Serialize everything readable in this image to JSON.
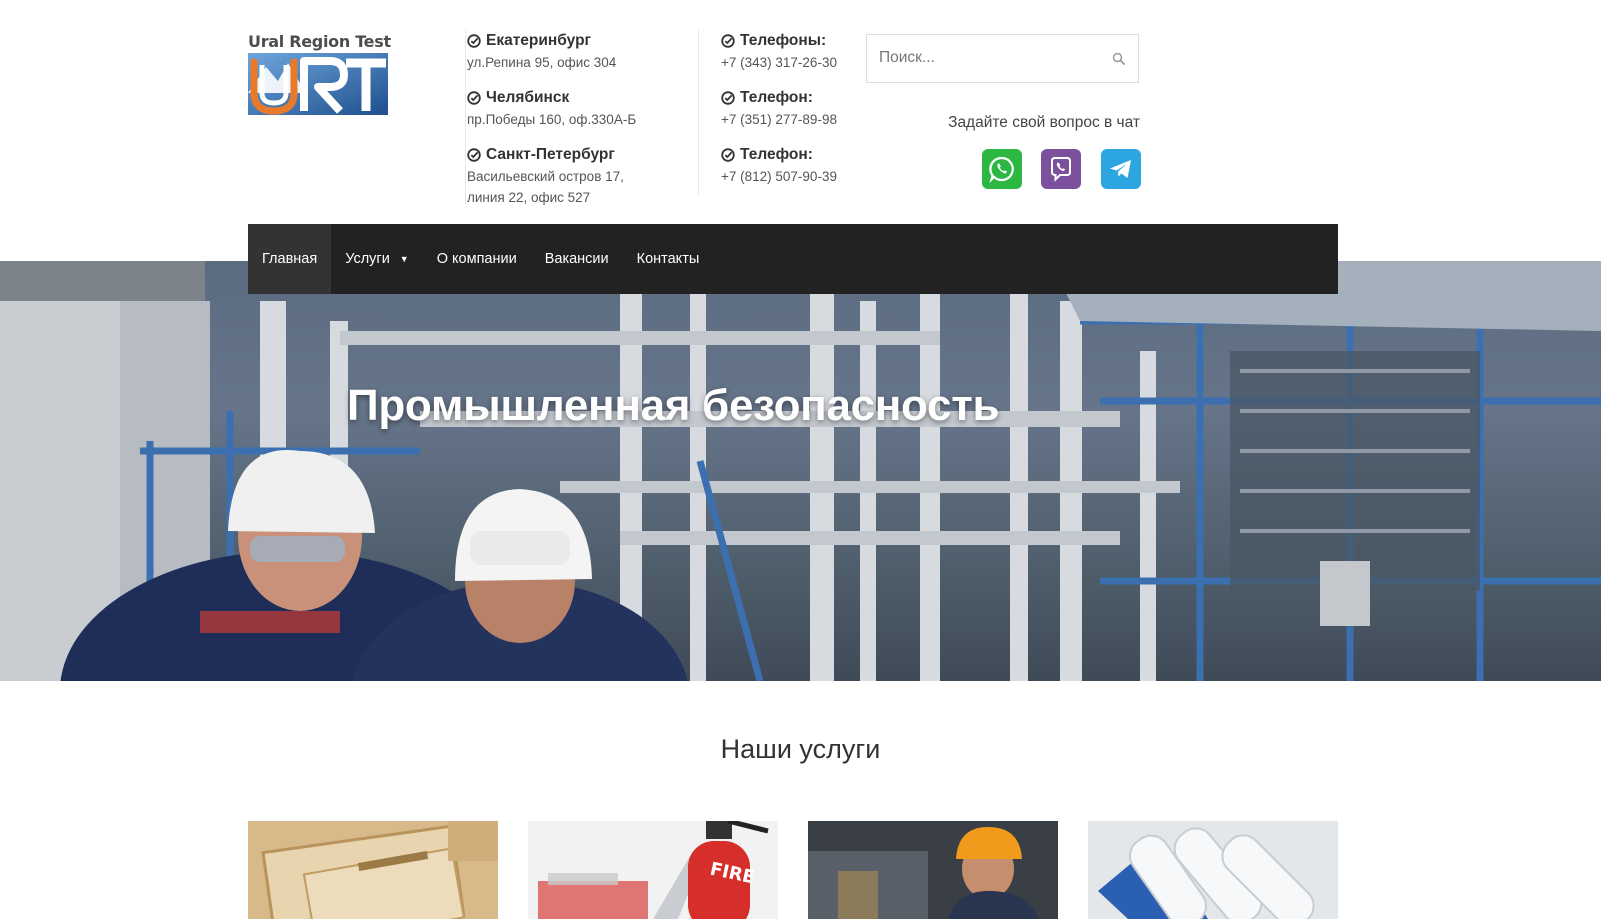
{
  "logo": {
    "text": "Ural Region Test",
    "mark": "URT"
  },
  "cities": [
    {
      "name": "Екатеринбург",
      "address": "ул.Репина 95, офис 304"
    },
    {
      "name": "Челябинск",
      "address": "пр.Победы 160, оф.330А-Б"
    },
    {
      "name": "Санкт-Петербург",
      "address": "Васильевский остров 17, линия 22, офис 527"
    }
  ],
  "phones": [
    {
      "label": "Телефоны:",
      "number": "+7 (343) 317-26-30"
    },
    {
      "label": "Телефон:",
      "number": "+7 (351) 277-89-98"
    },
    {
      "label": "Телефон:",
      "number": "+7 (812) 507-90-39"
    }
  ],
  "search": {
    "placeholder": "Поиск..."
  },
  "chat": {
    "label": "Задайте свой вопрос в чат",
    "messengers": [
      "whatsapp-icon",
      "viber-icon",
      "telegram-icon"
    ]
  },
  "nav": {
    "items": [
      {
        "label": "Главная",
        "active": true
      },
      {
        "label": "Услуги",
        "dropdown": true
      },
      {
        "label": "О компании"
      },
      {
        "label": "Вакансии"
      },
      {
        "label": "Контакты"
      }
    ]
  },
  "hero": {
    "title": "Промышленная безопасность"
  },
  "services": {
    "title": "Наши услуги"
  },
  "colors": {
    "nav_bg": "#222222",
    "nav_active": "#333333",
    "whatsapp": "#2bb741",
    "viber": "#7b519d",
    "telegram": "#2ca5e0",
    "logo_accent": "#e87a2a",
    "logo_blue": "#2f6fb4"
  }
}
